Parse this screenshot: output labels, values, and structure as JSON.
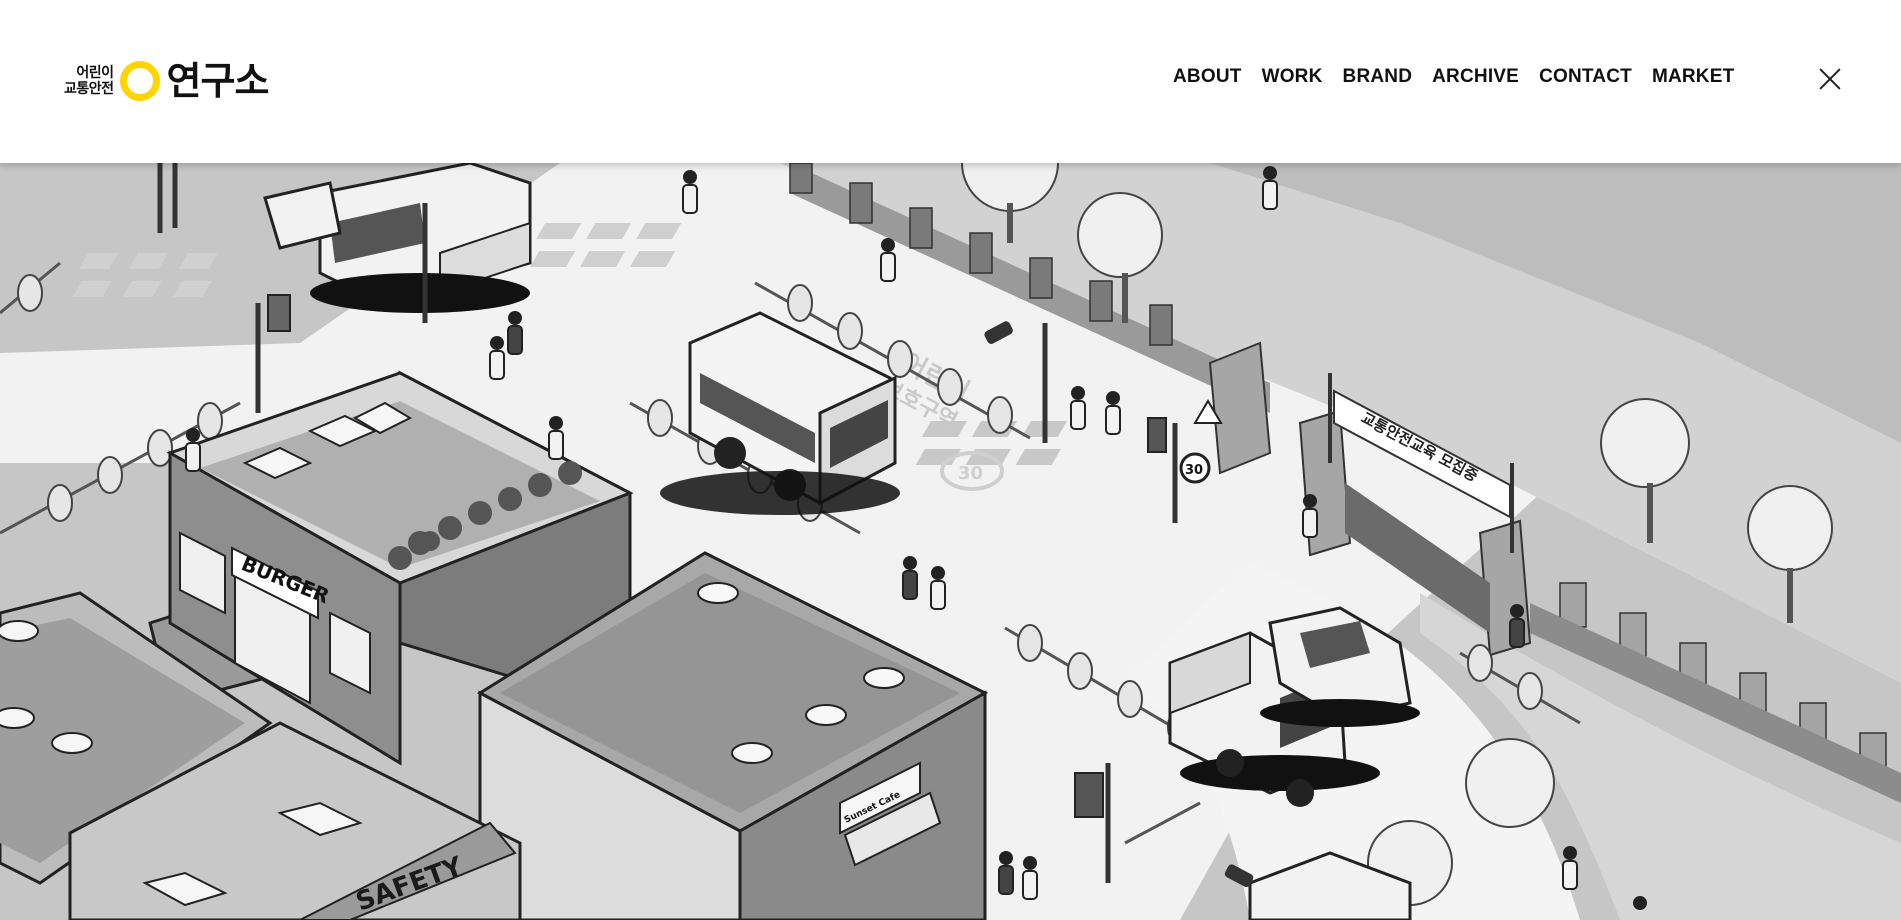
{
  "header": {
    "logo": {
      "small_line1": "어린이",
      "small_line2": "교통안전",
      "big": "연구소",
      "accent_color": "#ffd400"
    },
    "nav": [
      {
        "label": "ABOUT"
      },
      {
        "label": "WORK"
      },
      {
        "label": "BRAND"
      },
      {
        "label": "ARCHIVE"
      },
      {
        "label": "CONTACT"
      },
      {
        "label": "MARKET"
      }
    ],
    "close_icon": "close-icon"
  },
  "scene": {
    "signs": {
      "burger": "BURGER",
      "safety": "SAFETY",
      "banner": "교통안전교육 모집중",
      "speed_limit": "30",
      "school_zone_line1": "어린이",
      "school_zone_line2": "보호구역",
      "cafe": "Sunset Cafe"
    }
  }
}
